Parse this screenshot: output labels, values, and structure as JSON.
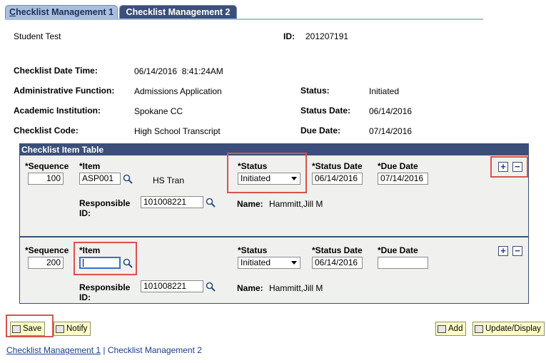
{
  "tabs": {
    "tab1": {
      "prefix": "C",
      "rest": "hecklist Management 1"
    },
    "tab2": "Checklist Management 2"
  },
  "header": {
    "name": "Student Test",
    "id_label": "ID:",
    "id_value": "201207191",
    "date_time_label": "Checklist Date Time:",
    "date_time_value": "06/14/2016  8:41:24AM",
    "admin_function_label": "Administrative Function:",
    "admin_function_value": "Admissions Application",
    "status_label": "Status:",
    "status_value": "Initiated",
    "institution_label": "Academic Institution:",
    "institution_value": "Spokane CC",
    "status_date_label": "Status Date:",
    "status_date_value": "06/14/2016",
    "code_label": "Checklist Code:",
    "code_value": "High School Transcript",
    "due_date_label": "Due Date:",
    "due_date_value": "07/14/2016"
  },
  "grid": {
    "title": "Checklist Item Table",
    "sequence_label": "*Sequence",
    "item_label": "*Item",
    "status_label": "*Status",
    "status_date_label": "*Status Date",
    "due_date_label": "*Due Date",
    "responsible_label_1": "Responsible",
    "responsible_label_2": "ID:",
    "name_label": "Name:",
    "rows": [
      {
        "sequence": "100",
        "item": "ASP001",
        "item_desc": "HS Tran",
        "status": "Initiated",
        "status_date": "06/14/2016",
        "due_date": "07/14/2016",
        "responsible_id": "101008221",
        "name": "Hammitt,Jill M"
      },
      {
        "sequence": "200",
        "item": "",
        "item_desc": "",
        "status": "Initiated",
        "status_date": "06/14/2016",
        "due_date": "",
        "responsible_id": "101008221",
        "name": "Hammitt,Jill M"
      }
    ],
    "add_row_symbol": "+",
    "delete_row_symbol": "−"
  },
  "buttons": {
    "save": "Save",
    "notify": "Notify",
    "add": "Add",
    "update_display": "Update/Display"
  },
  "footer": {
    "link1": "Checklist Management 1",
    "separator": " | ",
    "link2": "Checklist Management 2"
  },
  "colors": {
    "tab_active": "#3c4f7a",
    "tab_inactive": "#a9bfdd",
    "grid_header": "#3c4f7a",
    "highlight": "#d9534f",
    "button_bg": "#ffffc8"
  }
}
